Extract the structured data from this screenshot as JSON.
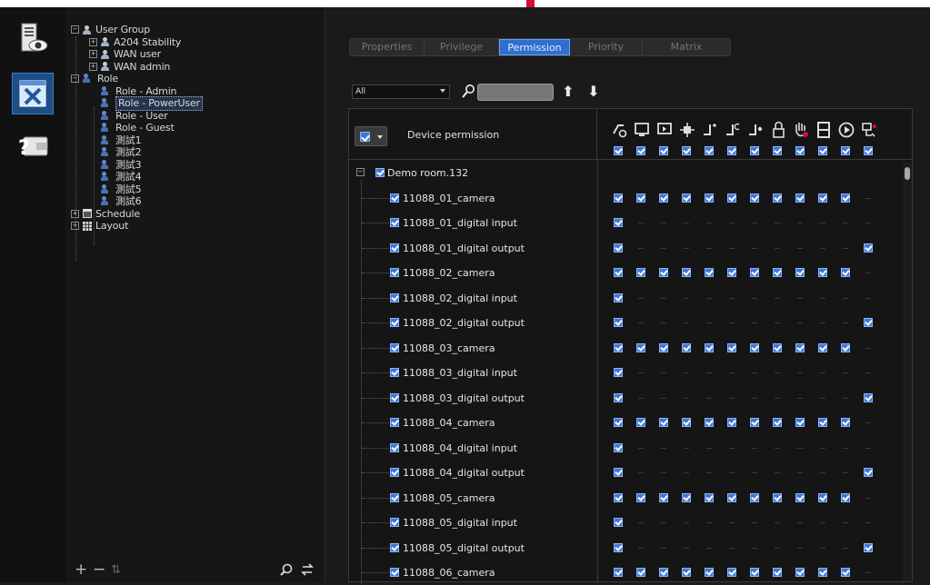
{
  "nav": {
    "buttons": [
      {
        "name": "device-monitor-button",
        "icon": "computer-eye-icon"
      },
      {
        "name": "settings-tools-button",
        "icon": "tools-icon",
        "active": true
      },
      {
        "name": "help-wallet-button",
        "icon": "help-wallet-icon"
      }
    ]
  },
  "tree": {
    "user_group": "User Group",
    "groups": [
      "A204 Stability",
      "WAN user",
      "WAN admin"
    ],
    "role": "Role",
    "roles": [
      "Role - Admin",
      "Role - PowerUser",
      "Role - User",
      "Role - Guest",
      "測試1",
      "測試2",
      "測試3",
      "測試4",
      "測試5",
      "測試6"
    ],
    "selected_role": "Role - PowerUser",
    "schedule": "Schedule",
    "layout": "Layout",
    "bottom": {
      "add": "+",
      "remove": "−",
      "sort": "⇅",
      "search_icon": "search-icon",
      "refresh_icon": "swap-icon"
    }
  },
  "tabs": {
    "items": [
      "Properties",
      "Privilege",
      "Permission",
      "Priority",
      "Matrix"
    ],
    "active": "Permission"
  },
  "filter": {
    "value": "All"
  },
  "grid": {
    "header_label": "Device permission",
    "perm_icons": [
      "link-settings-icon",
      "monitor-icon",
      "monitor-arrow-icon",
      "ptz-icon",
      "digital-out-on-icon",
      "digital-out-off-icon",
      "digital-out-pulse-icon",
      "lock-icon",
      "hand-stop-icon",
      "film-icon",
      "play-icon",
      "camera-key-icon"
    ],
    "group_name": "Demo room.132",
    "devices": [
      {
        "name": "11088_01_camera",
        "perms": [
          1,
          1,
          1,
          1,
          1,
          1,
          1,
          1,
          1,
          1,
          1,
          0
        ]
      },
      {
        "name": "11088_01_digital input",
        "perms": [
          1,
          0,
          0,
          0,
          0,
          0,
          0,
          0,
          0,
          0,
          0,
          0
        ]
      },
      {
        "name": "11088_01_digital output",
        "perms": [
          1,
          0,
          0,
          0,
          0,
          0,
          0,
          0,
          0,
          0,
          0,
          1
        ]
      },
      {
        "name": "11088_02_camera",
        "perms": [
          1,
          1,
          1,
          1,
          1,
          1,
          1,
          1,
          1,
          1,
          1,
          0
        ]
      },
      {
        "name": "11088_02_digital input",
        "perms": [
          1,
          0,
          0,
          0,
          0,
          0,
          0,
          0,
          0,
          0,
          0,
          0
        ]
      },
      {
        "name": "11088_02_digital output",
        "perms": [
          1,
          0,
          0,
          0,
          0,
          0,
          0,
          0,
          0,
          0,
          0,
          1
        ]
      },
      {
        "name": "11088_03_camera",
        "perms": [
          1,
          1,
          1,
          1,
          1,
          1,
          1,
          1,
          1,
          1,
          1,
          0
        ]
      },
      {
        "name": "11088_03_digital input",
        "perms": [
          1,
          0,
          0,
          0,
          0,
          0,
          0,
          0,
          0,
          0,
          0,
          0
        ]
      },
      {
        "name": "11088_03_digital output",
        "perms": [
          1,
          0,
          0,
          0,
          0,
          0,
          0,
          0,
          0,
          0,
          0,
          1
        ]
      },
      {
        "name": "11088_04_camera",
        "perms": [
          1,
          1,
          1,
          1,
          1,
          1,
          1,
          1,
          1,
          1,
          1,
          0
        ]
      },
      {
        "name": "11088_04_digital input",
        "perms": [
          1,
          0,
          0,
          0,
          0,
          0,
          0,
          0,
          0,
          0,
          0,
          0
        ]
      },
      {
        "name": "11088_04_digital output",
        "perms": [
          1,
          0,
          0,
          0,
          0,
          0,
          0,
          0,
          0,
          0,
          0,
          1
        ]
      },
      {
        "name": "11088_05_camera",
        "perms": [
          1,
          1,
          1,
          1,
          1,
          1,
          1,
          1,
          1,
          1,
          1,
          0
        ]
      },
      {
        "name": "11088_05_digital input",
        "perms": [
          1,
          0,
          0,
          0,
          0,
          0,
          0,
          0,
          0,
          0,
          0,
          0
        ]
      },
      {
        "name": "11088_05_digital output",
        "perms": [
          1,
          0,
          0,
          0,
          0,
          0,
          0,
          0,
          0,
          0,
          0,
          1
        ]
      },
      {
        "name": "11088_06_camera",
        "perms": [
          1,
          1,
          1,
          1,
          1,
          1,
          1,
          1,
          1,
          1,
          1,
          0
        ]
      }
    ]
  },
  "colors": {
    "accent": "#2e6fd1",
    "checkbox": "#3d77dc",
    "indicator": "#d2103a"
  }
}
